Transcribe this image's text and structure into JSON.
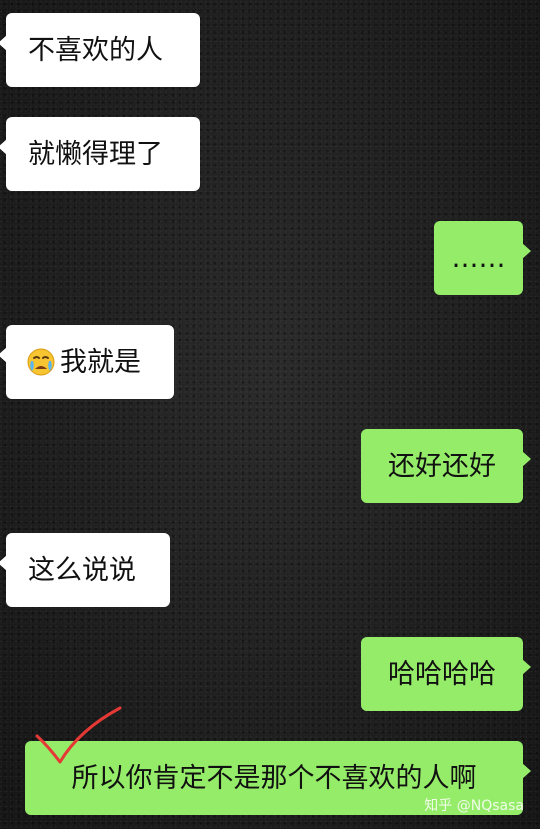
{
  "messages": [
    {
      "side": "in",
      "text": "不喜欢的人"
    },
    {
      "side": "in",
      "text": "就懒得理了"
    },
    {
      "side": "out",
      "text": "……"
    },
    {
      "side": "in",
      "emoji": "crying-face-emoji",
      "text": "我就是"
    },
    {
      "side": "out",
      "text": "还好还好"
    },
    {
      "side": "in",
      "text": "这么说说"
    },
    {
      "side": "out",
      "text": "哈哈哈哈"
    },
    {
      "side": "out",
      "text": "所以你肯定不是那个不喜欢的人啊",
      "annotation": "red-check-mark"
    }
  ],
  "watermark": "知乎 @NQsasa",
  "colors": {
    "incoming_bubble": "#ffffff",
    "outgoing_bubble": "#95ec69",
    "annotation": "#e53935",
    "background": "#1b1b1b"
  }
}
